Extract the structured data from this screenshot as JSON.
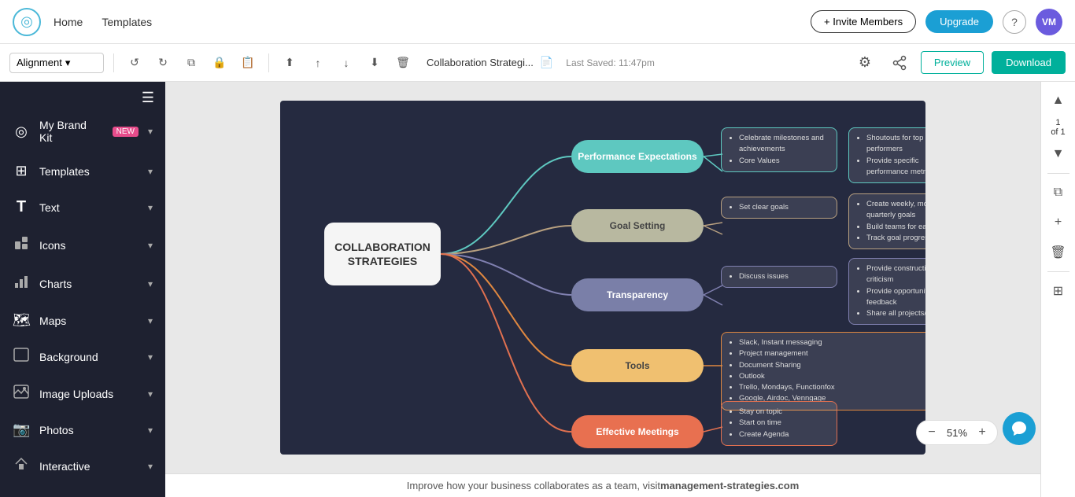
{
  "topnav": {
    "logo_symbol": "◎",
    "links": [
      "Home",
      "Templates"
    ],
    "invite_label": "+ Invite Members",
    "upgrade_label": "Upgrade",
    "help_symbol": "?",
    "avatar_text": "VM"
  },
  "toolbar": {
    "alignment_label": "Alignment",
    "alignment_arrow": "▾",
    "undo_icon": "↺",
    "redo_icon": "↻",
    "copy_icon": "⧉",
    "lock_icon": "🔒",
    "paste_icon": "📋",
    "bring_front_icon": "⬆",
    "bring_up_icon": "↑",
    "send_down_icon": "↓",
    "send_back_icon": "⬇",
    "delete_icon": "🗑",
    "doc_title": "Collaboration Strategi...",
    "doc_icon": "📄",
    "last_saved": "Last Saved: 11:47pm",
    "gear_icon": "⚙",
    "share_icon": "⚬",
    "preview_label": "Preview",
    "download_label": "Download"
  },
  "sidebar": {
    "hamburger": "☰",
    "items": [
      {
        "id": "brand-kit",
        "icon": "◎",
        "label": "My Brand Kit",
        "badge": "NEW",
        "arrow": "▾"
      },
      {
        "id": "templates",
        "icon": "⊞",
        "label": "Templates",
        "badge": "",
        "arrow": "▾"
      },
      {
        "id": "text",
        "icon": "T",
        "label": "Text",
        "badge": "",
        "arrow": "▾"
      },
      {
        "id": "icons",
        "icon": "☻",
        "label": "Icons",
        "badge": "",
        "arrow": "▾"
      },
      {
        "id": "charts",
        "icon": "📊",
        "label": "Charts",
        "badge": "",
        "arrow": "▾"
      },
      {
        "id": "maps",
        "icon": "🗺",
        "label": "Maps",
        "badge": "",
        "arrow": "▾"
      },
      {
        "id": "background",
        "icon": "□",
        "label": "Background",
        "badge": "",
        "arrow": "▾"
      },
      {
        "id": "image-uploads",
        "icon": "🖼",
        "label": "Image Uploads",
        "badge": "",
        "arrow": "▾"
      },
      {
        "id": "photos",
        "icon": "📷",
        "label": "Photos",
        "badge": "",
        "arrow": "▾"
      },
      {
        "id": "interactive",
        "icon": "⚡",
        "label": "Interactive",
        "badge": "",
        "arrow": "▾"
      }
    ]
  },
  "canvas": {
    "title": "COLLABORATION STRATEGIES",
    "nodes": {
      "performance": "Performance Expectations",
      "goal": "Goal Setting",
      "transparency": "Transparency",
      "tools": "Tools",
      "meetings": "Effective Meetings"
    },
    "details": {
      "perf1": [
        "Celebrate milestones and achievements",
        "Core Values"
      ],
      "perf2": [
        "Shoutouts for top performers",
        "Provide specific performance metrics"
      ],
      "goal1": [
        "Set clear goals"
      ],
      "goal2": [
        "Create weekly, monthly, quarterly goals",
        "Build teams for each goal",
        "Track goal progression"
      ],
      "transp1": [
        "Discuss issues"
      ],
      "transp2": [
        "Provide constructive criticism",
        "Provide opportunity for feedback",
        "Share all projects/goals"
      ],
      "tools1": [
        "Slack, Instant messaging",
        "Project management",
        "Document Sharing",
        "Outlook",
        "Trello, Mondays, Functionfox",
        "Google, Airdoc, Venngage"
      ],
      "meetings1": [
        "Stay on topic",
        "Start on time",
        "Create Agenda"
      ]
    }
  },
  "right_panel": {
    "up_arrow": "▲",
    "page_of": "1",
    "total": "of 1",
    "down_arrow": "▼",
    "copy_page": "⧉",
    "add_page": "+",
    "delete_page": "🗑",
    "grid_icon": "⊞"
  },
  "zoom": {
    "minus": "−",
    "value": "51%",
    "plus": "+"
  },
  "bottom_bar": {
    "text": "Improve how your business collaborates as a team, visit ",
    "link": "management-strategies.com"
  }
}
